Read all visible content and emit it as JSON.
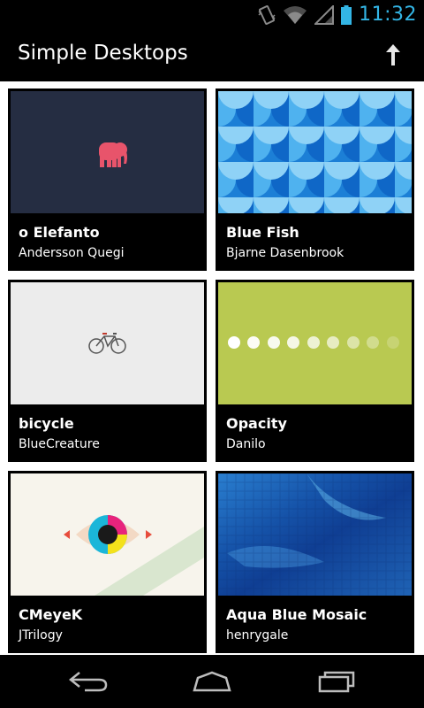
{
  "status_bar": {
    "time": "11:32",
    "icons": [
      "vibrate-icon",
      "wifi-icon",
      "signal-icon",
      "battery-icon"
    ]
  },
  "action_bar": {
    "title": "Simple Desktops",
    "share_icon": "upload-arrow-icon"
  },
  "wallpapers": [
    {
      "title": "o Elefanto",
      "author": "Andersson Quegi",
      "thumb": "elephant"
    },
    {
      "title": "Blue Fish",
      "author": "Bjarne Dasenbrook",
      "thumb": "blue-scales"
    },
    {
      "title": "bicycle",
      "author": "BlueCreature",
      "thumb": "bicycle"
    },
    {
      "title": "Opacity",
      "author": "Danilo",
      "thumb": "dots-opacity"
    },
    {
      "title": "CMeyeK",
      "author": "JTrilogy",
      "thumb": "cmyk-eye"
    },
    {
      "title": "Aqua Blue Mosaic",
      "author": "henrygale",
      "thumb": "blue-mosaic"
    }
  ],
  "nav_bar": {
    "icons": [
      "back-icon",
      "home-icon",
      "recent-apps-icon"
    ]
  }
}
